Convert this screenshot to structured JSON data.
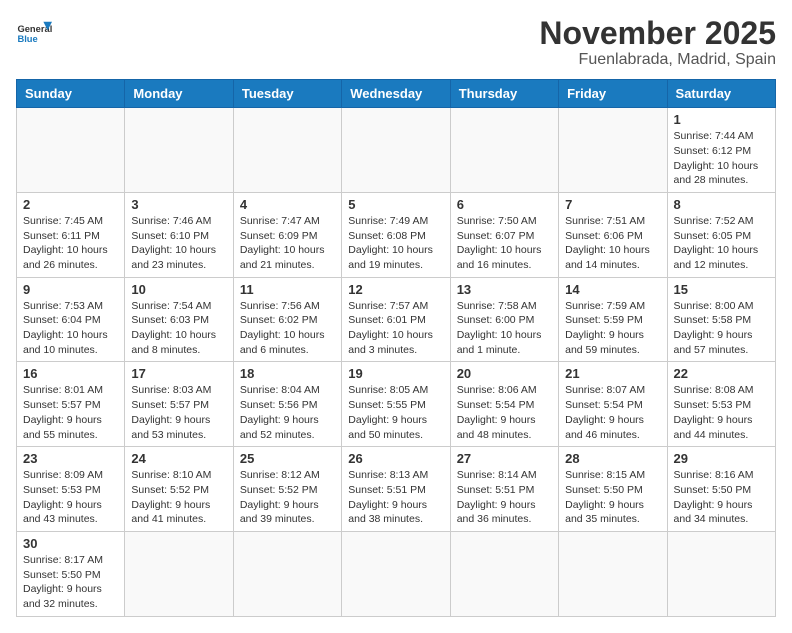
{
  "header": {
    "logo_text_general": "General",
    "logo_text_blue": "Blue",
    "title": "November 2025",
    "subtitle": "Fuenlabrada, Madrid, Spain"
  },
  "calendar": {
    "days_of_week": [
      "Sunday",
      "Monday",
      "Tuesday",
      "Wednesday",
      "Thursday",
      "Friday",
      "Saturday"
    ],
    "weeks": [
      [
        {
          "day": "",
          "info": ""
        },
        {
          "day": "",
          "info": ""
        },
        {
          "day": "",
          "info": ""
        },
        {
          "day": "",
          "info": ""
        },
        {
          "day": "",
          "info": ""
        },
        {
          "day": "",
          "info": ""
        },
        {
          "day": "1",
          "info": "Sunrise: 7:44 AM\nSunset: 6:12 PM\nDaylight: 10 hours and 28 minutes."
        }
      ],
      [
        {
          "day": "2",
          "info": "Sunrise: 7:45 AM\nSunset: 6:11 PM\nDaylight: 10 hours and 26 minutes."
        },
        {
          "day": "3",
          "info": "Sunrise: 7:46 AM\nSunset: 6:10 PM\nDaylight: 10 hours and 23 minutes."
        },
        {
          "day": "4",
          "info": "Sunrise: 7:47 AM\nSunset: 6:09 PM\nDaylight: 10 hours and 21 minutes."
        },
        {
          "day": "5",
          "info": "Sunrise: 7:49 AM\nSunset: 6:08 PM\nDaylight: 10 hours and 19 minutes."
        },
        {
          "day": "6",
          "info": "Sunrise: 7:50 AM\nSunset: 6:07 PM\nDaylight: 10 hours and 16 minutes."
        },
        {
          "day": "7",
          "info": "Sunrise: 7:51 AM\nSunset: 6:06 PM\nDaylight: 10 hours and 14 minutes."
        },
        {
          "day": "8",
          "info": "Sunrise: 7:52 AM\nSunset: 6:05 PM\nDaylight: 10 hours and 12 minutes."
        }
      ],
      [
        {
          "day": "9",
          "info": "Sunrise: 7:53 AM\nSunset: 6:04 PM\nDaylight: 10 hours and 10 minutes."
        },
        {
          "day": "10",
          "info": "Sunrise: 7:54 AM\nSunset: 6:03 PM\nDaylight: 10 hours and 8 minutes."
        },
        {
          "day": "11",
          "info": "Sunrise: 7:56 AM\nSunset: 6:02 PM\nDaylight: 10 hours and 6 minutes."
        },
        {
          "day": "12",
          "info": "Sunrise: 7:57 AM\nSunset: 6:01 PM\nDaylight: 10 hours and 3 minutes."
        },
        {
          "day": "13",
          "info": "Sunrise: 7:58 AM\nSunset: 6:00 PM\nDaylight: 10 hours and 1 minute."
        },
        {
          "day": "14",
          "info": "Sunrise: 7:59 AM\nSunset: 5:59 PM\nDaylight: 9 hours and 59 minutes."
        },
        {
          "day": "15",
          "info": "Sunrise: 8:00 AM\nSunset: 5:58 PM\nDaylight: 9 hours and 57 minutes."
        }
      ],
      [
        {
          "day": "16",
          "info": "Sunrise: 8:01 AM\nSunset: 5:57 PM\nDaylight: 9 hours and 55 minutes."
        },
        {
          "day": "17",
          "info": "Sunrise: 8:03 AM\nSunset: 5:57 PM\nDaylight: 9 hours and 53 minutes."
        },
        {
          "day": "18",
          "info": "Sunrise: 8:04 AM\nSunset: 5:56 PM\nDaylight: 9 hours and 52 minutes."
        },
        {
          "day": "19",
          "info": "Sunrise: 8:05 AM\nSunset: 5:55 PM\nDaylight: 9 hours and 50 minutes."
        },
        {
          "day": "20",
          "info": "Sunrise: 8:06 AM\nSunset: 5:54 PM\nDaylight: 9 hours and 48 minutes."
        },
        {
          "day": "21",
          "info": "Sunrise: 8:07 AM\nSunset: 5:54 PM\nDaylight: 9 hours and 46 minutes."
        },
        {
          "day": "22",
          "info": "Sunrise: 8:08 AM\nSunset: 5:53 PM\nDaylight: 9 hours and 44 minutes."
        }
      ],
      [
        {
          "day": "23",
          "info": "Sunrise: 8:09 AM\nSunset: 5:53 PM\nDaylight: 9 hours and 43 minutes."
        },
        {
          "day": "24",
          "info": "Sunrise: 8:10 AM\nSunset: 5:52 PM\nDaylight: 9 hours and 41 minutes."
        },
        {
          "day": "25",
          "info": "Sunrise: 8:12 AM\nSunset: 5:52 PM\nDaylight: 9 hours and 39 minutes."
        },
        {
          "day": "26",
          "info": "Sunrise: 8:13 AM\nSunset: 5:51 PM\nDaylight: 9 hours and 38 minutes."
        },
        {
          "day": "27",
          "info": "Sunrise: 8:14 AM\nSunset: 5:51 PM\nDaylight: 9 hours and 36 minutes."
        },
        {
          "day": "28",
          "info": "Sunrise: 8:15 AM\nSunset: 5:50 PM\nDaylight: 9 hours and 35 minutes."
        },
        {
          "day": "29",
          "info": "Sunrise: 8:16 AM\nSunset: 5:50 PM\nDaylight: 9 hours and 34 minutes."
        }
      ],
      [
        {
          "day": "30",
          "info": "Sunrise: 8:17 AM\nSunset: 5:50 PM\nDaylight: 9 hours and 32 minutes."
        },
        {
          "day": "",
          "info": ""
        },
        {
          "day": "",
          "info": ""
        },
        {
          "day": "",
          "info": ""
        },
        {
          "day": "",
          "info": ""
        },
        {
          "day": "",
          "info": ""
        },
        {
          "day": "",
          "info": ""
        }
      ]
    ]
  }
}
